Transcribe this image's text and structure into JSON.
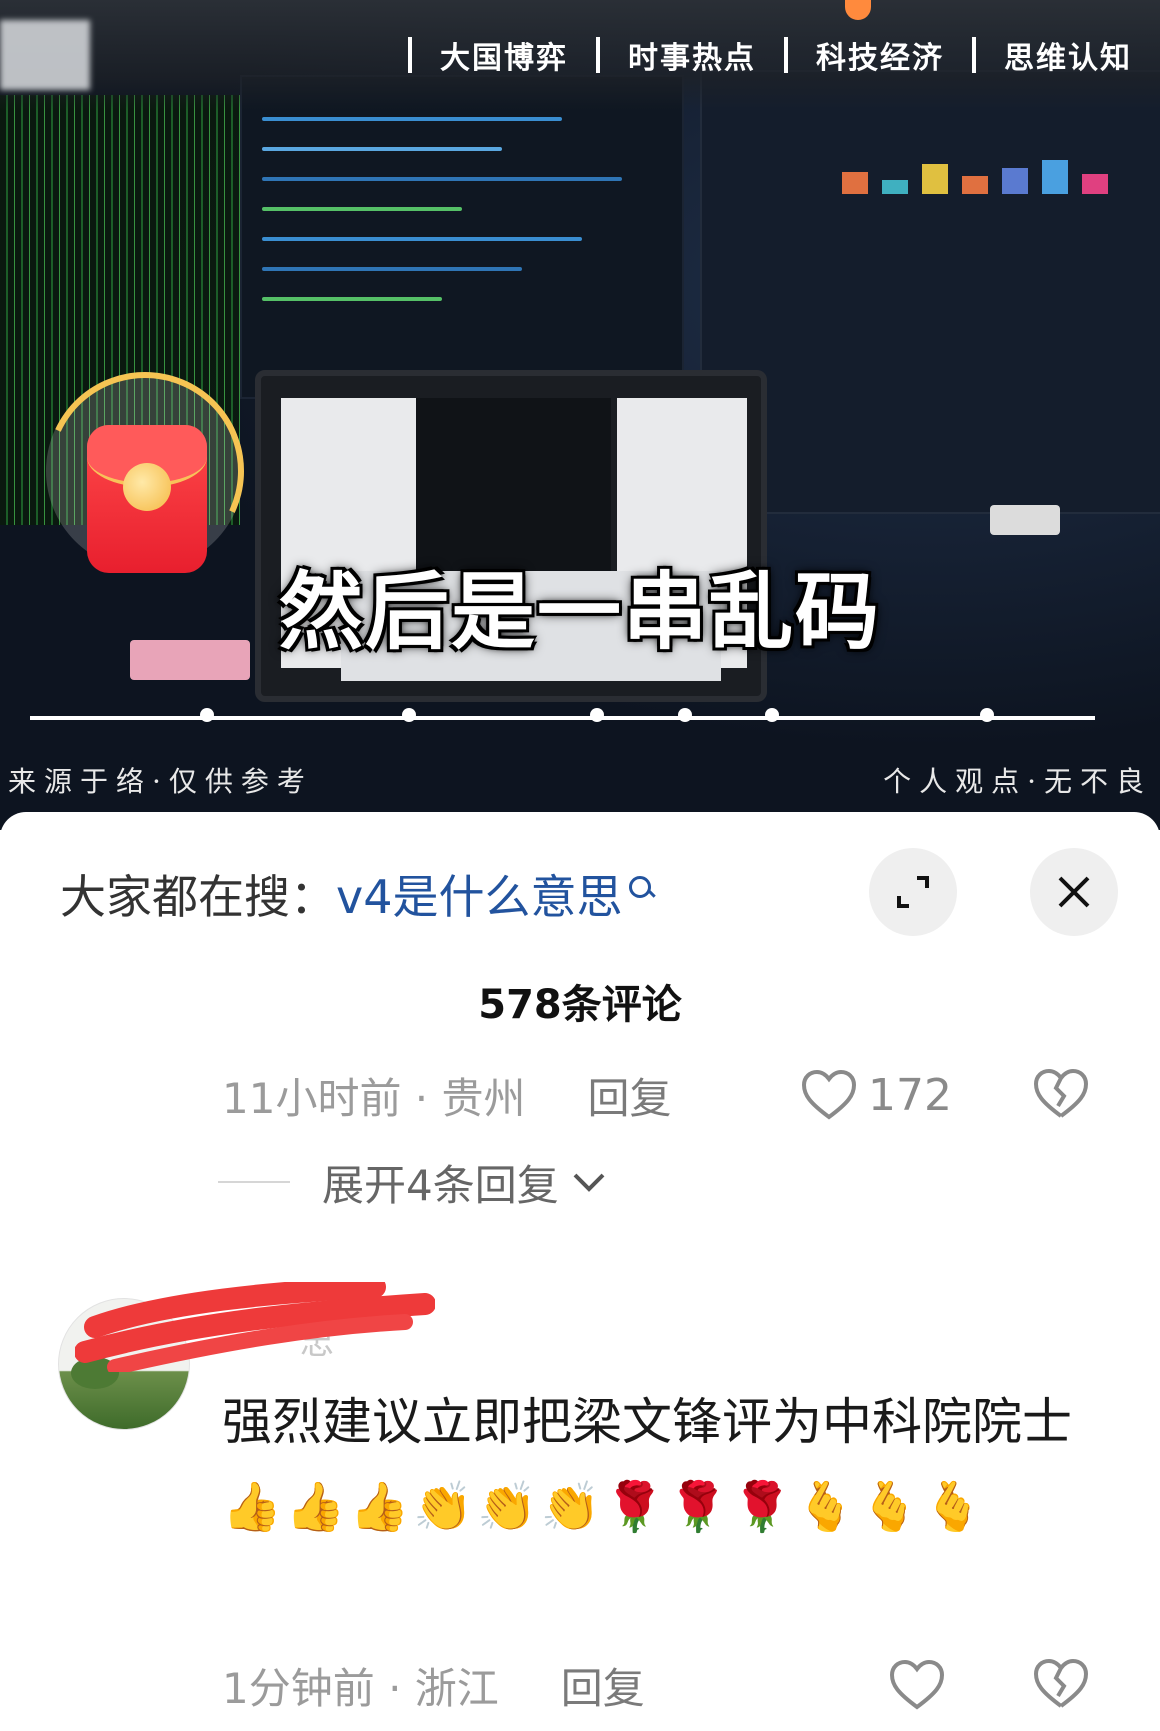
{
  "nav": {
    "items": [
      "大国博弈",
      "时事热点",
      "科技经济",
      "思维认知"
    ]
  },
  "video": {
    "subtitle": "然后是一串乱码",
    "caption_left": "来源于络·仅供参考",
    "caption_right": "个人观点·无不良"
  },
  "sheet": {
    "search_label": "大家都在搜：",
    "search_term": "v4是什么意思",
    "comment_count": "578条评论"
  },
  "comment1": {
    "meta": "11小时前 · 贵州",
    "reply_label": "回复",
    "likes": "172"
  },
  "expand_replies": "展开4条回复",
  "comment2": {
    "username_partial": "忠",
    "text": "强烈建议立即把梁文锋评为中科院院士",
    "emojis": "👍👍👍👏👏👏🌹🌹🌹🫰🫰🫰",
    "meta": "1分钟前 · 浙江",
    "reply_label": "回复"
  },
  "colors": {
    "search_term": "#22539e",
    "gold_ring": "#f6c453",
    "red_packet": "#e81f2e"
  }
}
